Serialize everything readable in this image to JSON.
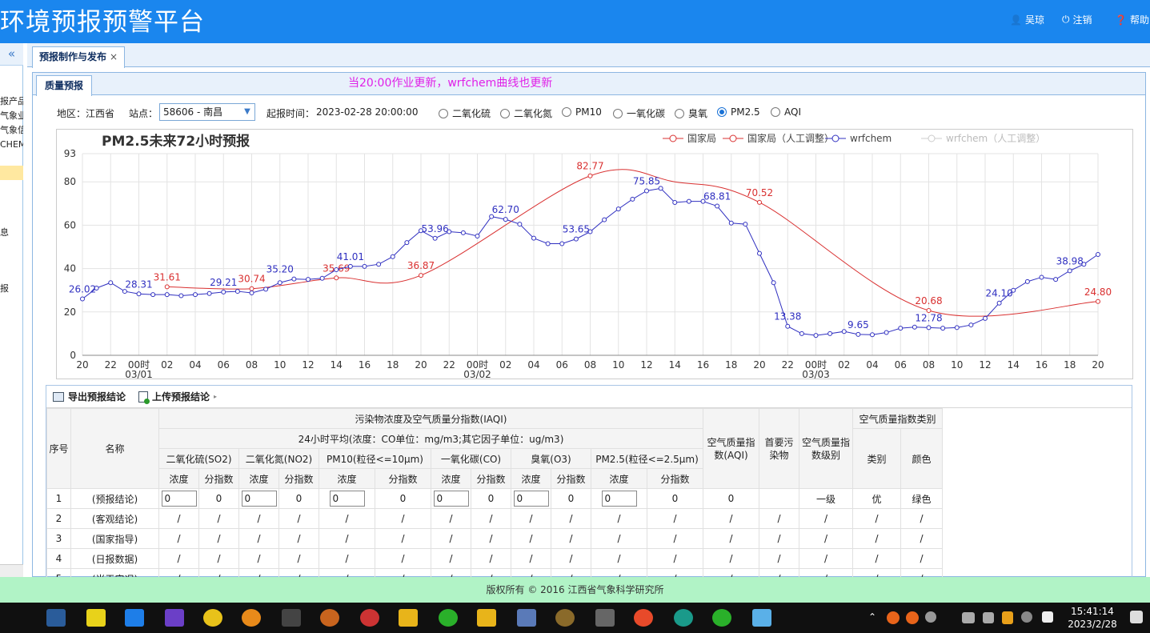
{
  "header": {
    "title": "环境预报预警平台",
    "user": "吴琼",
    "logout": "注销",
    "help": "帮助"
  },
  "sidebar": {
    "collapse": "«",
    "items": [
      "报产品",
      "气象业",
      "气象信",
      "CHEM引",
      "息",
      "报"
    ]
  },
  "tabs": [
    {
      "label": "预报制作与发布",
      "close": "×"
    }
  ],
  "panel": {
    "subtab": "质量预报",
    "notice": "当20:00作业更新，wrfchem曲线也更新"
  },
  "filters": {
    "region_label": "地区：",
    "region": "江西省",
    "station_label": "站点：",
    "station": "58606 - 南昌",
    "time_label": "起报时间：",
    "time": "2023-02-28 20:00:00",
    "pollutants": [
      "二氧化硫",
      "二氧化氮",
      "PM10",
      "一氧化碳",
      "臭氧",
      "PM2.5",
      "AQI"
    ],
    "selected": "PM2.5"
  },
  "chart_data": {
    "type": "line",
    "title": "PM2.5未来72小时预报",
    "ylim": [
      0,
      93
    ],
    "yticks": [
      0,
      20,
      40,
      60,
      80,
      93
    ],
    "xlim": [
      0,
      72
    ],
    "xticks": [
      {
        "x": 0,
        "label": "20"
      },
      {
        "x": 2,
        "label": "22"
      },
      {
        "x": 4,
        "label": "00时",
        "sub": "03/01"
      },
      {
        "x": 6,
        "label": "02"
      },
      {
        "x": 8,
        "label": "04"
      },
      {
        "x": 10,
        "label": "06"
      },
      {
        "x": 12,
        "label": "08"
      },
      {
        "x": 14,
        "label": "10"
      },
      {
        "x": 16,
        "label": "12"
      },
      {
        "x": 18,
        "label": "14"
      },
      {
        "x": 20,
        "label": "16"
      },
      {
        "x": 22,
        "label": "18"
      },
      {
        "x": 24,
        "label": "20"
      },
      {
        "x": 26,
        "label": "22"
      },
      {
        "x": 28,
        "label": "00时",
        "sub": "03/02"
      },
      {
        "x": 30,
        "label": "02"
      },
      {
        "x": 32,
        "label": "04"
      },
      {
        "x": 34,
        "label": "06"
      },
      {
        "x": 36,
        "label": "08"
      },
      {
        "x": 38,
        "label": "10"
      },
      {
        "x": 40,
        "label": "12"
      },
      {
        "x": 42,
        "label": "14"
      },
      {
        "x": 44,
        "label": "16"
      },
      {
        "x": 46,
        "label": "18"
      },
      {
        "x": 48,
        "label": "20"
      },
      {
        "x": 50,
        "label": "22"
      },
      {
        "x": 52,
        "label": "00时",
        "sub": "03/03"
      },
      {
        "x": 54,
        "label": "02"
      },
      {
        "x": 56,
        "label": "04"
      },
      {
        "x": 58,
        "label": "06"
      },
      {
        "x": 60,
        "label": "08"
      },
      {
        "x": 62,
        "label": "10"
      },
      {
        "x": 64,
        "label": "12"
      },
      {
        "x": 66,
        "label": "14"
      },
      {
        "x": 68,
        "label": "16"
      },
      {
        "x": 70,
        "label": "18"
      },
      {
        "x": 72,
        "label": "20"
      }
    ],
    "grid": true,
    "legend": "top-right",
    "series": [
      {
        "name": "国家局",
        "color": "#d93030",
        "smooth": true,
        "points": [
          [
            6,
            31.61
          ],
          [
            12,
            30.74
          ],
          [
            18,
            35.69
          ],
          [
            24,
            36.87
          ],
          [
            36,
            82.77
          ],
          [
            42,
            80
          ],
          [
            48,
            70.52
          ],
          [
            60,
            20.68
          ],
          [
            72,
            24.8
          ]
        ],
        "labels": [
          [
            6,
            31.61,
            "31.61"
          ],
          [
            12,
            30.74,
            "30.74"
          ],
          [
            18,
            35.69,
            "35.69"
          ],
          [
            24,
            36.87,
            "36.87"
          ],
          [
            36,
            82.77,
            "82.77"
          ],
          [
            48,
            70.52,
            "70.52"
          ],
          [
            60,
            20.68,
            "20.68"
          ],
          [
            72,
            24.8,
            "24.80"
          ]
        ]
      },
      {
        "name": "国家局（人工调整）",
        "color": "#d93030",
        "points": [],
        "labels": []
      },
      {
        "name": "wrfchem",
        "color": "#3030c0",
        "points": [
          [
            0,
            26.02
          ],
          [
            1,
            31
          ],
          [
            2,
            33.5
          ],
          [
            3,
            29.5
          ],
          [
            4,
            28.31
          ],
          [
            5,
            28
          ],
          [
            6,
            28
          ],
          [
            7,
            27.5
          ],
          [
            8,
            28
          ],
          [
            9,
            28.5
          ],
          [
            10,
            29.21
          ],
          [
            11,
            29.5
          ],
          [
            12,
            28.8
          ],
          [
            13,
            30.5
          ],
          [
            14,
            33.5
          ],
          [
            15,
            35.2
          ],
          [
            16,
            35
          ],
          [
            17,
            35.5
          ],
          [
            18,
            39.5
          ],
          [
            19,
            41.01
          ],
          [
            20,
            41
          ],
          [
            21,
            42
          ],
          [
            22,
            45.5
          ],
          [
            23,
            52
          ],
          [
            24,
            57.5
          ],
          [
            25,
            53.96
          ],
          [
            26,
            57
          ],
          [
            27,
            56.5
          ],
          [
            28,
            55
          ],
          [
            29,
            64
          ],
          [
            30,
            62.7
          ],
          [
            31,
            60.5
          ],
          [
            32,
            54
          ],
          [
            33,
            51.5
          ],
          [
            34,
            51.5
          ],
          [
            35,
            53.65
          ],
          [
            36,
            57
          ],
          [
            37,
            62.5
          ],
          [
            38,
            67.5
          ],
          [
            39,
            72
          ],
          [
            40,
            75.85
          ],
          [
            41,
            77
          ],
          [
            42,
            70.5
          ],
          [
            43,
            71
          ],
          [
            44,
            71
          ],
          [
            45,
            68.81
          ],
          [
            46,
            61
          ],
          [
            47,
            60.5
          ],
          [
            48,
            47
          ],
          [
            49,
            33.5
          ],
          [
            50,
            13.38
          ],
          [
            51,
            10
          ],
          [
            52,
            9.2
          ],
          [
            53,
            10
          ],
          [
            54,
            11
          ],
          [
            55,
            9.65
          ],
          [
            56,
            9.5
          ],
          [
            57,
            10.5
          ],
          [
            58,
            12.5
          ],
          [
            59,
            13
          ],
          [
            60,
            12.78
          ],
          [
            61,
            12.5
          ],
          [
            62,
            12.8
          ],
          [
            63,
            14
          ],
          [
            64,
            17
          ],
          [
            65,
            24.1
          ],
          [
            66,
            30
          ],
          [
            67,
            34
          ],
          [
            68,
            36
          ],
          [
            69,
            35
          ],
          [
            70,
            38.98
          ],
          [
            71,
            42
          ],
          [
            72,
            46.5
          ]
        ],
        "labels": [
          [
            0,
            26.02,
            "26.02"
          ],
          [
            4,
            28.31,
            "28.31"
          ],
          [
            10,
            29.21,
            "29.21"
          ],
          [
            14,
            35.2,
            "35.20"
          ],
          [
            19,
            41.01,
            "41.01"
          ],
          [
            25,
            53.96,
            "53.96"
          ],
          [
            30,
            62.7,
            "62.70"
          ],
          [
            35,
            53.65,
            "53.65"
          ],
          [
            40,
            75.85,
            "75.85"
          ],
          [
            45,
            68.81,
            "68.81"
          ],
          [
            50,
            13.38,
            "13.38"
          ],
          [
            55,
            9.65,
            "9.65"
          ],
          [
            60,
            12.78,
            "12.78"
          ],
          [
            65,
            24.1,
            "24.10"
          ],
          [
            70,
            38.98,
            "38.98"
          ]
        ]
      },
      {
        "name": "wrfchem（人工调整）",
        "color": "#cccccc",
        "points": [],
        "labels": []
      }
    ]
  },
  "table": {
    "export": "导出预报结论",
    "upload": "上传预报结论",
    "h_index": "序号",
    "h_name": "名称",
    "h_group": "污染物浓度及空气质量分指数(IAQI)",
    "h_avg": "24小时平均(浓度：CO单位：mg/m3;其它因子单位：ug/m3)",
    "h_aqi": "空气质量指数(AQI)",
    "h_primary": "首要污染物",
    "h_level": "空气质量指数级别",
    "h_cat_group": "空气质量指数类别",
    "h_cat": "类别",
    "h_color": "颜色",
    "pollutant_cols": [
      "二氧化硫(SO2)",
      "二氧化氮(NO2)",
      "PM10(粒径<=10μm)",
      "一氧化碳(CO)",
      "臭氧(O3)",
      "PM2.5(粒径<=2.5μm)"
    ],
    "conc": "浓度",
    "subidx": "分指数",
    "rows": [
      {
        "idx": "1",
        "name": "(预报结论)",
        "values": [
          "0",
          "0",
          "0",
          "0",
          "0",
          "0",
          "0",
          "0",
          "0",
          "0",
          "0",
          "0"
        ],
        "aqi": "0",
        "primary": "",
        "level": "一级",
        "cat": "优",
        "color": "绿色"
      },
      {
        "idx": "2",
        "name": "(客观结论)",
        "values": [
          "/",
          "/",
          "/",
          "/",
          "/",
          "/",
          "/",
          "/",
          "/",
          "/",
          "/",
          "/"
        ],
        "aqi": "/",
        "primary": "/",
        "level": "/",
        "cat": "/",
        "color": "/"
      },
      {
        "idx": "3",
        "name": "(国家指导)",
        "values": [
          "/",
          "/",
          "/",
          "/",
          "/",
          "/",
          "/",
          "/",
          "/",
          "/",
          "/",
          "/"
        ],
        "aqi": "/",
        "primary": "/",
        "level": "/",
        "cat": "/",
        "color": "/"
      },
      {
        "idx": "4",
        "name": "(日报数据)",
        "values": [
          "/",
          "/",
          "/",
          "/",
          "/",
          "/",
          "/",
          "/",
          "/",
          "/",
          "/",
          "/"
        ],
        "aqi": "/",
        "primary": "/",
        "level": "/",
        "cat": "/",
        "color": "/"
      },
      {
        "idx": "5",
        "name": "(当天实况)",
        "values": [
          "/",
          "/",
          "/",
          "/",
          "/",
          "/",
          "/",
          "/",
          "/",
          "/",
          "/",
          "/"
        ],
        "aqi": "/",
        "primary": "/",
        "level": "/",
        "cat": "/",
        "color": "/"
      }
    ]
  },
  "footer": "版权所有 © 2016 江西省气象科学研究所",
  "taskbar": {
    "time": "15:41:14",
    "date": "2023/2/28"
  }
}
